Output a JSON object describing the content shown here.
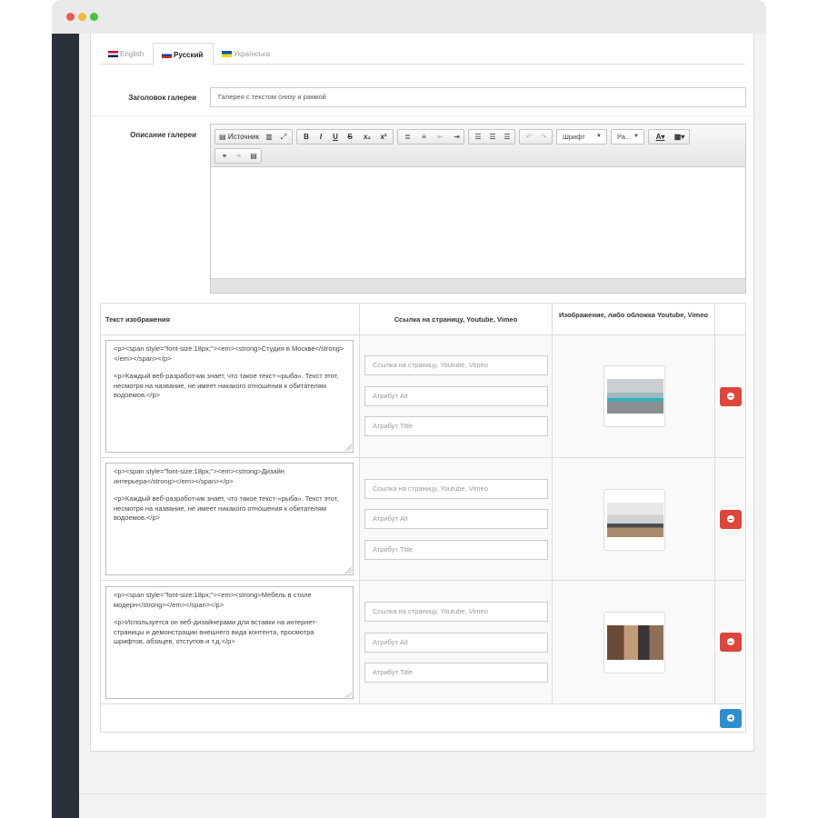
{
  "tabs": [
    {
      "label": "English",
      "flag": "gb"
    },
    {
      "label": "Русский",
      "flag": "ru"
    },
    {
      "label": "Українська",
      "flag": "ua"
    }
  ],
  "gallery_title": {
    "label": "Заголовок галереи",
    "value": "Галерея с текстом снизу и рамкой"
  },
  "gallery_description": {
    "label": "Описание галереи",
    "toolbar": {
      "source_label": "Источник",
      "bold": "B",
      "italic": "I",
      "underline": "U",
      "strike": "S",
      "subscript": "x₂",
      "superscript": "x²",
      "font_label": "Шрифт",
      "size_label": "Ра..."
    }
  },
  "table": {
    "headers": {
      "text": "Текст изображения",
      "link": "Ссылка на страницу, Youtube, Vimeo",
      "image": "Изображение, либо обложка Youtube, Vimeo"
    },
    "placeholders": {
      "link": "Ссылка на страницу, Youtube, Vimeo",
      "alt": "Атрибут Alt",
      "title": "Атрибут Title"
    },
    "rows": [
      {
        "line1": "<p><span style=\"font-size:18px;\"><em><strong>Студия в Москве</strong></em></span></p>",
        "line2": "<p>Каждый веб-разработчик знает, что такое текст-«рыба». Текст этот, несмотря на название, не имеет никакого отношения к обитателям водоемов.</p>"
      },
      {
        "line1": "<p><span style=\"font-size:18px;\"><em><strong>Дизайн интерьера</strong></em></span></p>",
        "line2": "<p>Каждый веб-разработчик знает, что такое текст-«рыба». Текст этот, несмотря на название, не имеет никакого отношения к обитателям водоемов.</p>"
      },
      {
        "line1": "<p><span style=\"font-size:18px;\"><em><strong>Мебель в стиле модерн</strong></em></span></p>",
        "line2": "<p>Используется он веб-дизайнерами для вставки на интернет-страницы и демонстрации внешнего вида контента, просмотра шрифтов, абзацев, отступов и т.д.</p>"
      }
    ]
  },
  "colors": {
    "remove_button": "#e0453b",
    "add_button": "#2d8fd1",
    "sidebar": "#2b313a"
  }
}
